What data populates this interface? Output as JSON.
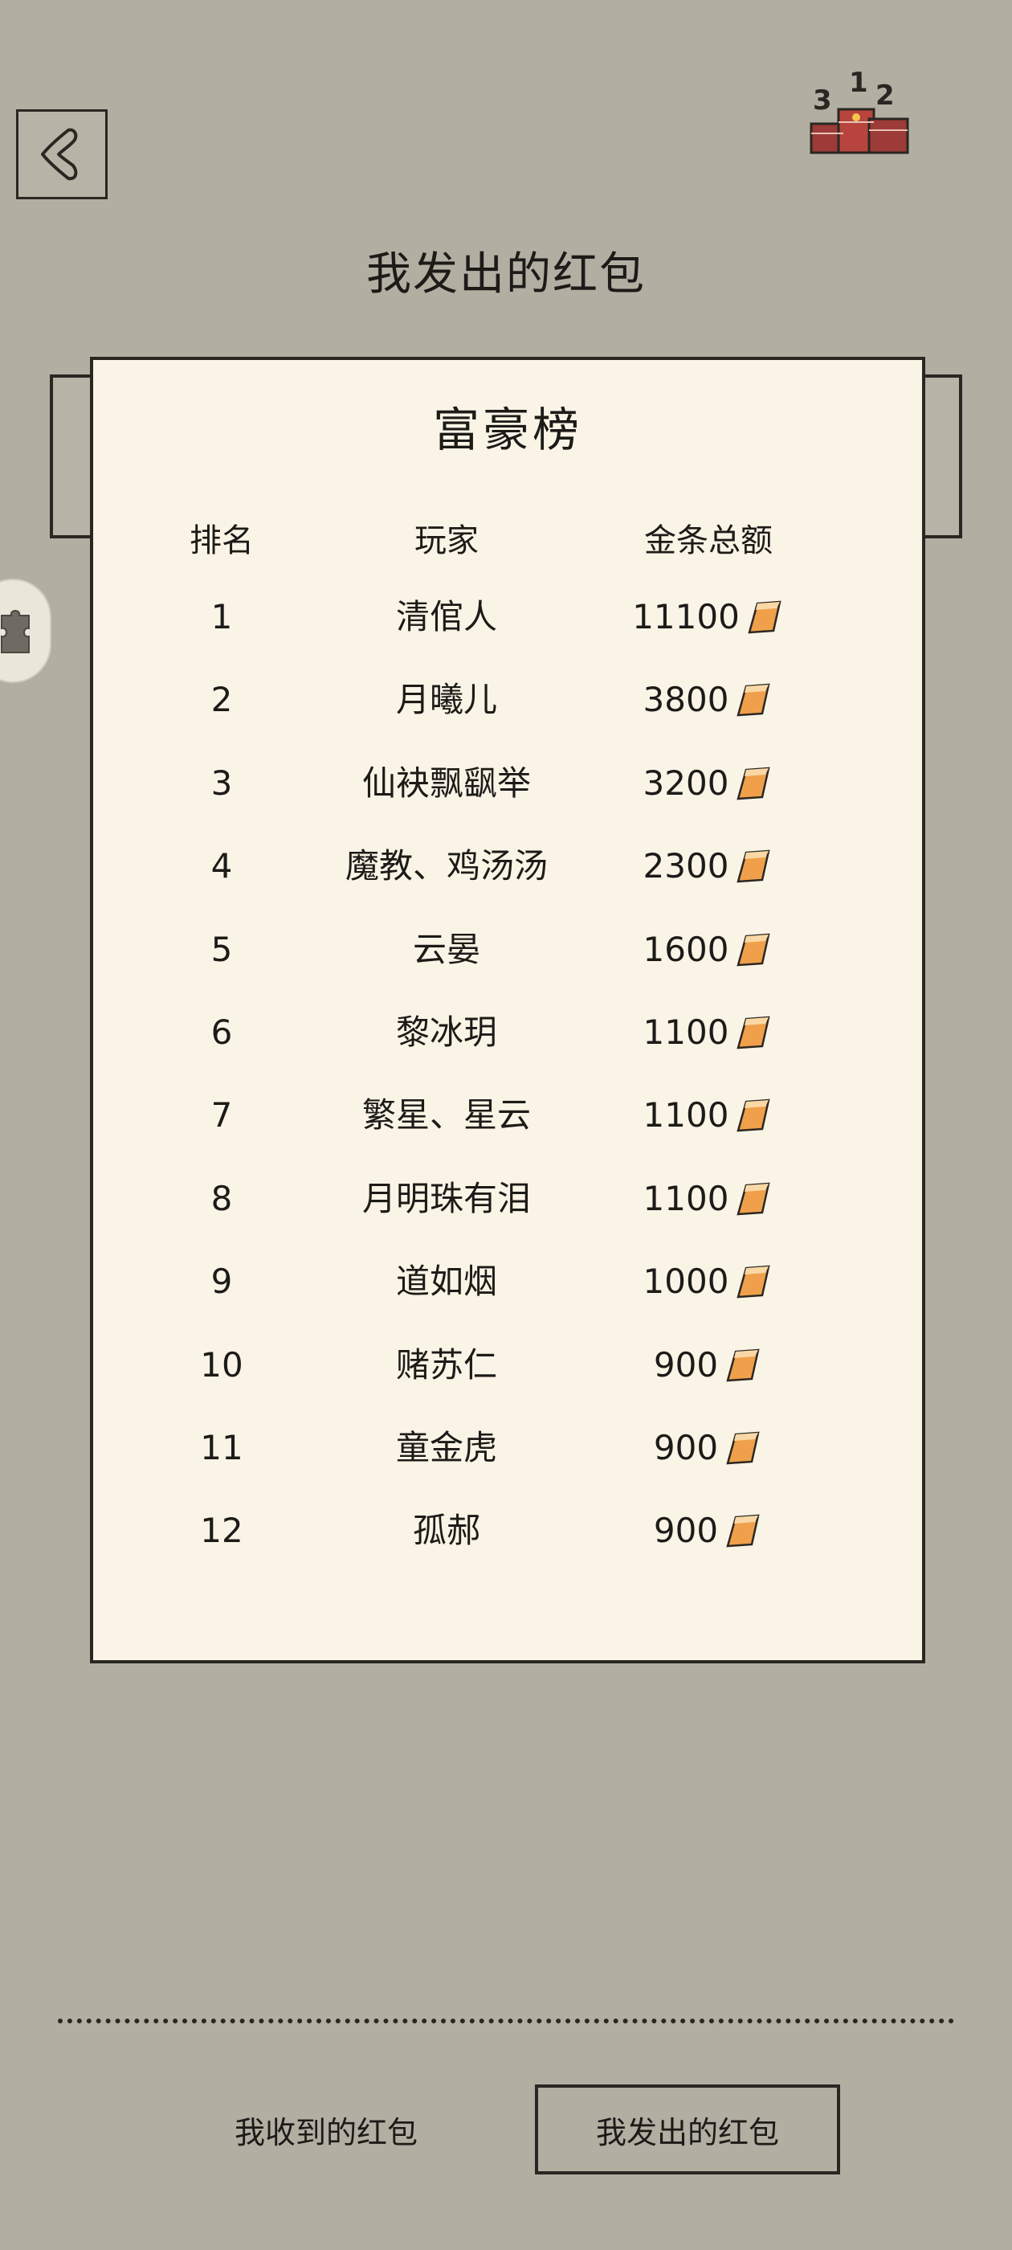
{
  "page": {
    "title": "我发出的红包"
  },
  "board": {
    "title": "富豪榜",
    "headers": {
      "rank": "排名",
      "player": "玩家",
      "gold": "金条总额"
    },
    "rows": [
      {
        "rank": "1",
        "player": "清倌人",
        "gold": "11100"
      },
      {
        "rank": "2",
        "player": "月曦儿",
        "gold": "3800"
      },
      {
        "rank": "3",
        "player": "仙袂飘飖举",
        "gold": "3200"
      },
      {
        "rank": "4",
        "player": "魔教、鸡汤汤",
        "gold": "2300"
      },
      {
        "rank": "5",
        "player": "云晏",
        "gold": "1600"
      },
      {
        "rank": "6",
        "player": "黎冰玥",
        "gold": "1100"
      },
      {
        "rank": "7",
        "player": "繁星、星云",
        "gold": "1100"
      },
      {
        "rank": "8",
        "player": "月明珠有泪",
        "gold": "1100"
      },
      {
        "rank": "9",
        "player": "道如烟",
        "gold": "1000"
      },
      {
        "rank": "10",
        "player": "赌苏仁",
        "gold": "900"
      },
      {
        "rank": "11",
        "player": "童金虎",
        "gold": "900"
      },
      {
        "rank": "12",
        "player": "孤郝",
        "gold": "900"
      }
    ]
  },
  "tabs": {
    "received": "我收到的红包",
    "sent": "我发出的红包",
    "active": "sent"
  },
  "icons": {
    "back": "back-arrow-icon",
    "ranking": "red-envelope-podium-icon",
    "gold": "gold-bar-icon",
    "side": "puzzle-icon"
  },
  "colors": {
    "background": "#b2aea2",
    "board": "#faf4e6",
    "ink": "#2a2723",
    "gold": "#e8903c"
  }
}
